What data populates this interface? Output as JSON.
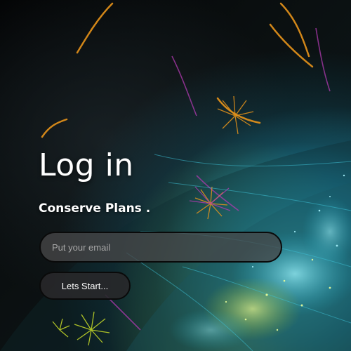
{
  "login": {
    "title": "Log in",
    "subtitle": "Conserve Plans .",
    "email_placeholder": "Put your email",
    "email_value": "",
    "start_label": "Lets Start..."
  },
  "colors": {
    "background": "#050607",
    "field_background": "#464648",
    "button_background": "#28282a",
    "text": "#ffffff",
    "accent_cyan": "#3cbed2",
    "accent_orange": "#e8941a",
    "accent_magenta": "#b03ab0",
    "accent_lime": "#c8dc28"
  },
  "icons": {
    "background": "fractal-flower-artwork"
  }
}
